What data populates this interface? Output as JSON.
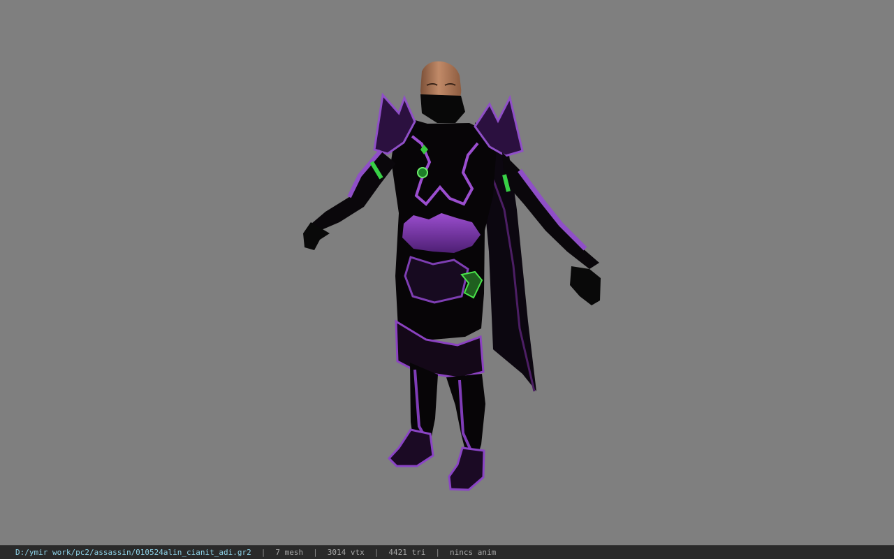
{
  "viewer": {
    "background_color": "#7f7f7f",
    "model_icon": "assassin-character-model"
  },
  "status": {
    "file_path": "D:/ymir work/pc2/assassin/010524alin_cianit_adi.gr2",
    "separator": "|",
    "mesh_count": "7 mesh",
    "vertex_count": "3014 vtx",
    "triangle_count": "4421 tri",
    "animation": "nincs anim",
    "path_color": "#8fd3e8"
  }
}
